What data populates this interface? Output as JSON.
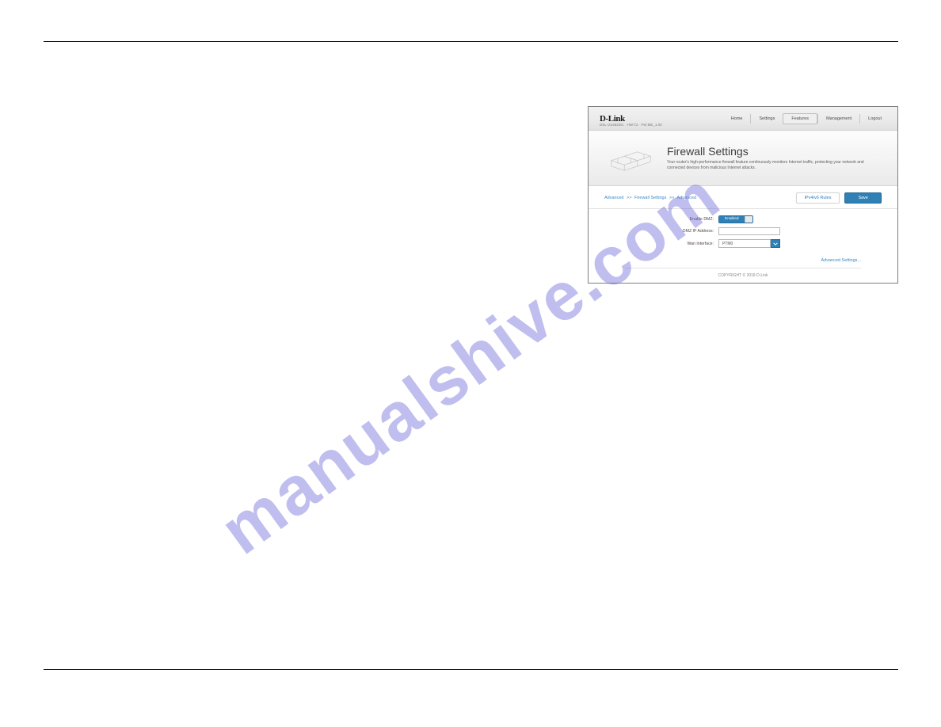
{
  "watermark": "manualshive.com",
  "header": {
    "logo": "D-Link",
    "subline": "DSL-G2452DG · HW:T2 · FW:ME_1.00",
    "nav": [
      "Home",
      "Settings",
      "Features",
      "Management",
      "Logout"
    ],
    "active_nav_index": 2
  },
  "title": {
    "heading": "Firewall Settings",
    "description": "Your router's high-performance firewall feature continuously monitors Internet traffic, protecting your network and connected devices from malicious Internet attacks."
  },
  "breadcrumb": {
    "items": [
      "Advanced",
      "Firewall Settings",
      "Advanced"
    ],
    "separator": ">>"
  },
  "buttons": {
    "rules": "IPv4/v6 Rules",
    "save": "Save"
  },
  "form": {
    "enable_dmz_label": "Enable DMZ:",
    "enable_dmz_state": "Enabled",
    "dmz_ip_label": "DMZ IP Address:",
    "dmz_ip_value": "",
    "wan_if_label": "Wan Interface:",
    "wan_if_value": "PTM0"
  },
  "advanced_link": "Advanced Settings...",
  "footer": "COPYRIGHT © 2018 D-Link"
}
